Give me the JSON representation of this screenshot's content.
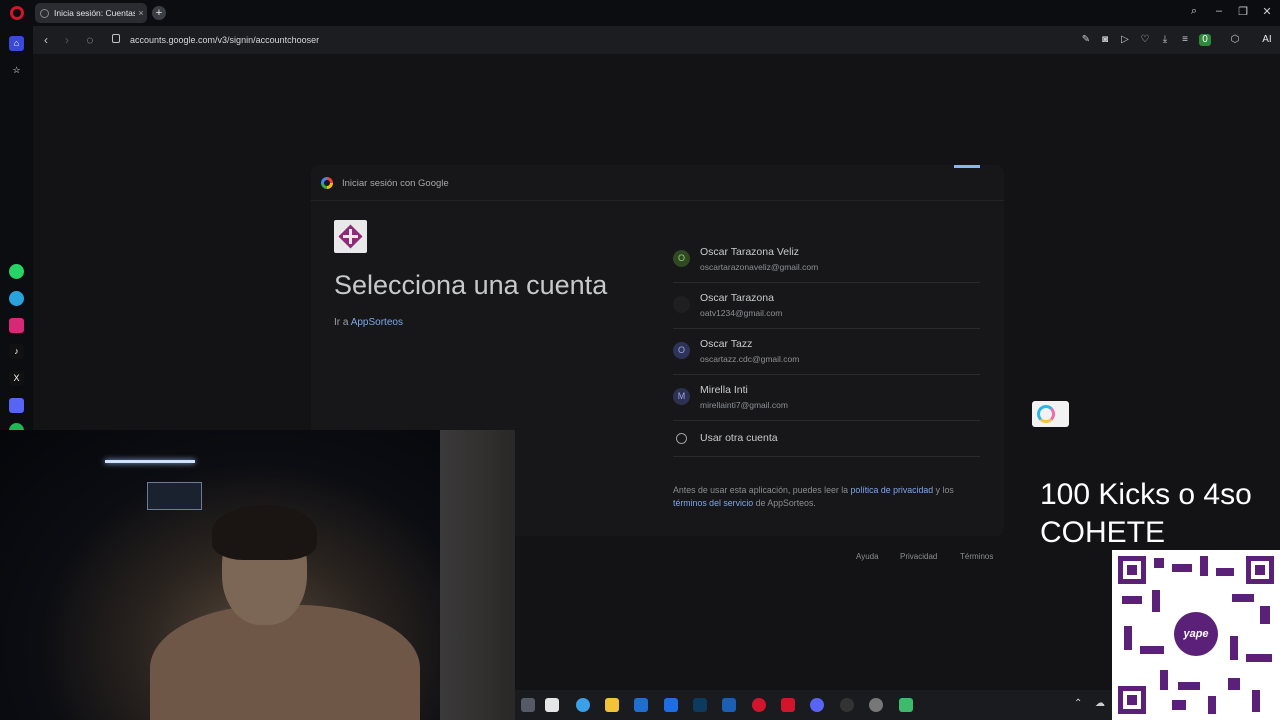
{
  "browser": {
    "tab_title": "Inicia sesión: Cuentas de",
    "url": "accounts.google.com/v3/signin/accountchooser",
    "toolbar_badge": "0",
    "ai_label": "AI"
  },
  "sidebar": {
    "items": [
      "home-icon",
      "bookmarks-icon",
      "whatsapp-icon",
      "telegram-icon",
      "instagram-icon",
      "tiktok-icon",
      "x-icon",
      "discord-icon",
      "spotify-icon"
    ]
  },
  "dialog": {
    "header_title": "Iniciar sesión con Google",
    "heading": "Selecciona una cuenta",
    "goto_prefix": "Ir a",
    "goto_app": "AppSorteos",
    "accounts": [
      {
        "initial": "O",
        "name": "Oscar Tarazona Veliz",
        "email": "oscartarazonaveliz@gmail.com",
        "avatar_color": "#2f4a22"
      },
      {
        "initial": "",
        "name": "Oscar Tarazona",
        "email": "oatv1234@gmail.com",
        "avatar_color": "#1f1f22"
      },
      {
        "initial": "O",
        "name": "Oscar Tazz",
        "email": "oscartazz.cdc@gmail.com",
        "avatar_color": "#2e3358"
      },
      {
        "initial": "M",
        "name": "Mirella Inti",
        "email": "mirellainti7@gmail.com",
        "avatar_color": "#2c3152"
      }
    ],
    "other_account": "Usar otra cuenta",
    "disclaimer": {
      "before": "Antes de usar esta aplicación, puedes leer la",
      "privacy_link": "política de privacidad",
      "and": "y los",
      "terms_link": "términos del servicio",
      "after": "de AppSorteos."
    }
  },
  "footer": {
    "help": "Ayuda",
    "privacy": "Privacidad",
    "terms": "Términos"
  },
  "stream_overlay": {
    "line1": "100 Kicks o 4so",
    "line2": "COHETE",
    "qr_brand": "yape"
  },
  "colors": {
    "accent_link": "#7fa7e6",
    "opera_red": "#d0152c",
    "yape_purple": "#5b2078"
  }
}
